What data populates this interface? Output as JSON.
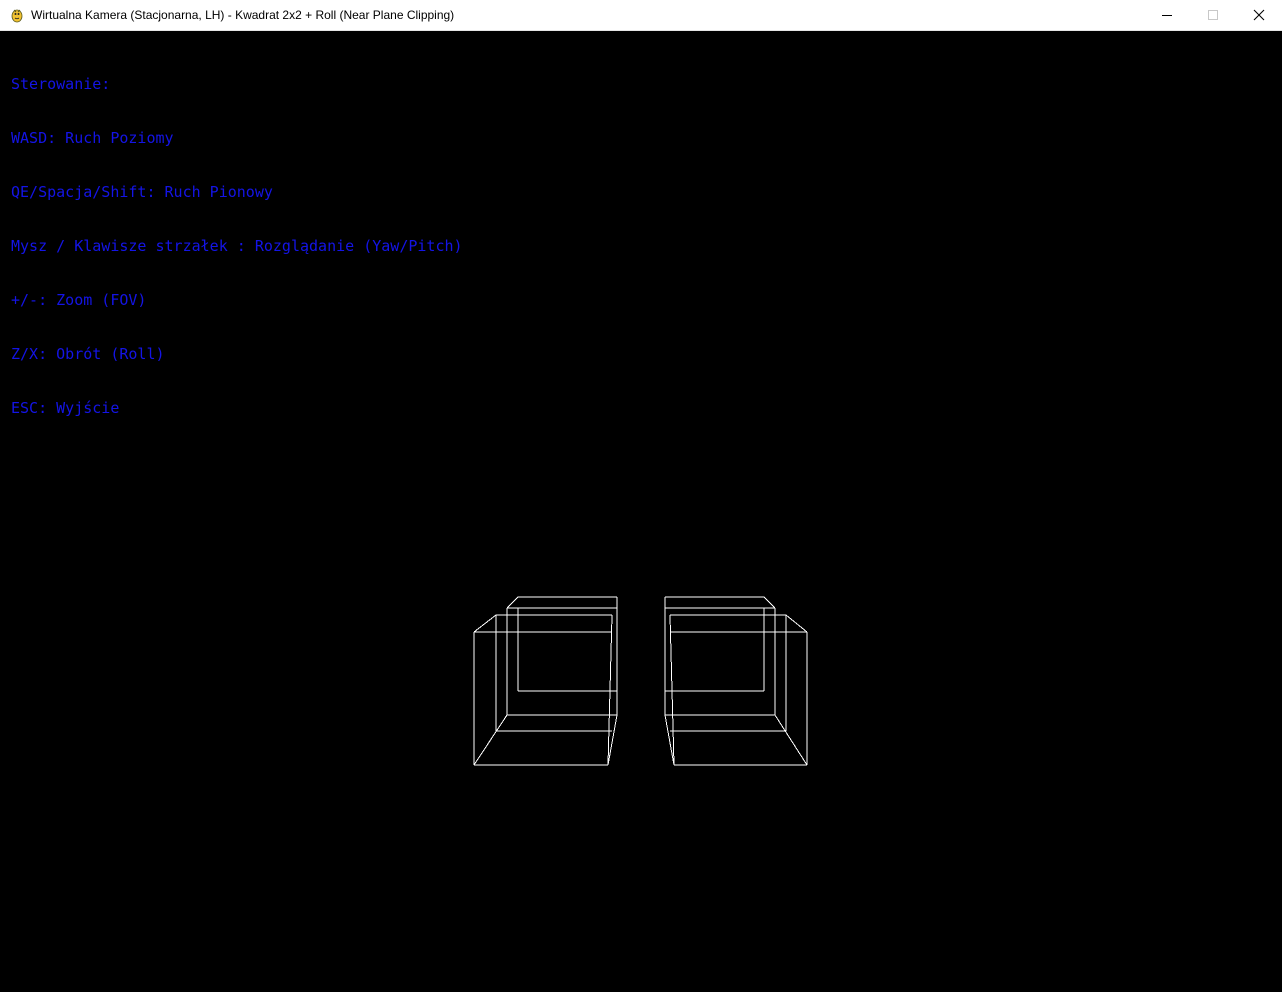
{
  "window": {
    "title": "Wirtualna Kamera (Stacjonarna, LH) - Kwadrat 2x2 + Roll (Near Plane Clipping)",
    "icon": "pygame-snake-icon",
    "buttons": {
      "minimize": "minimize-icon",
      "maximize": "maximize-icon",
      "close": "close-icon"
    }
  },
  "overlay": {
    "color": "#1414e6",
    "lines": [
      "Sterowanie:",
      "WASD: Ruch Poziomy",
      "QE/Spacja/Shift: Ruch Pionowy",
      "Mysz / Klawisze strzałek : Rozglądanie (Yaw/Pitch)",
      "+/-: Zoom (FOV)",
      "Z/X: Obrót (Roll)",
      "ESC: Wyjście"
    ]
  },
  "scene": {
    "background": "#000000",
    "wireframe_color": "#ffffff",
    "object_count": 2,
    "objects": [
      "left-wireframe-cube",
      "right-wireframe-cube"
    ]
  }
}
